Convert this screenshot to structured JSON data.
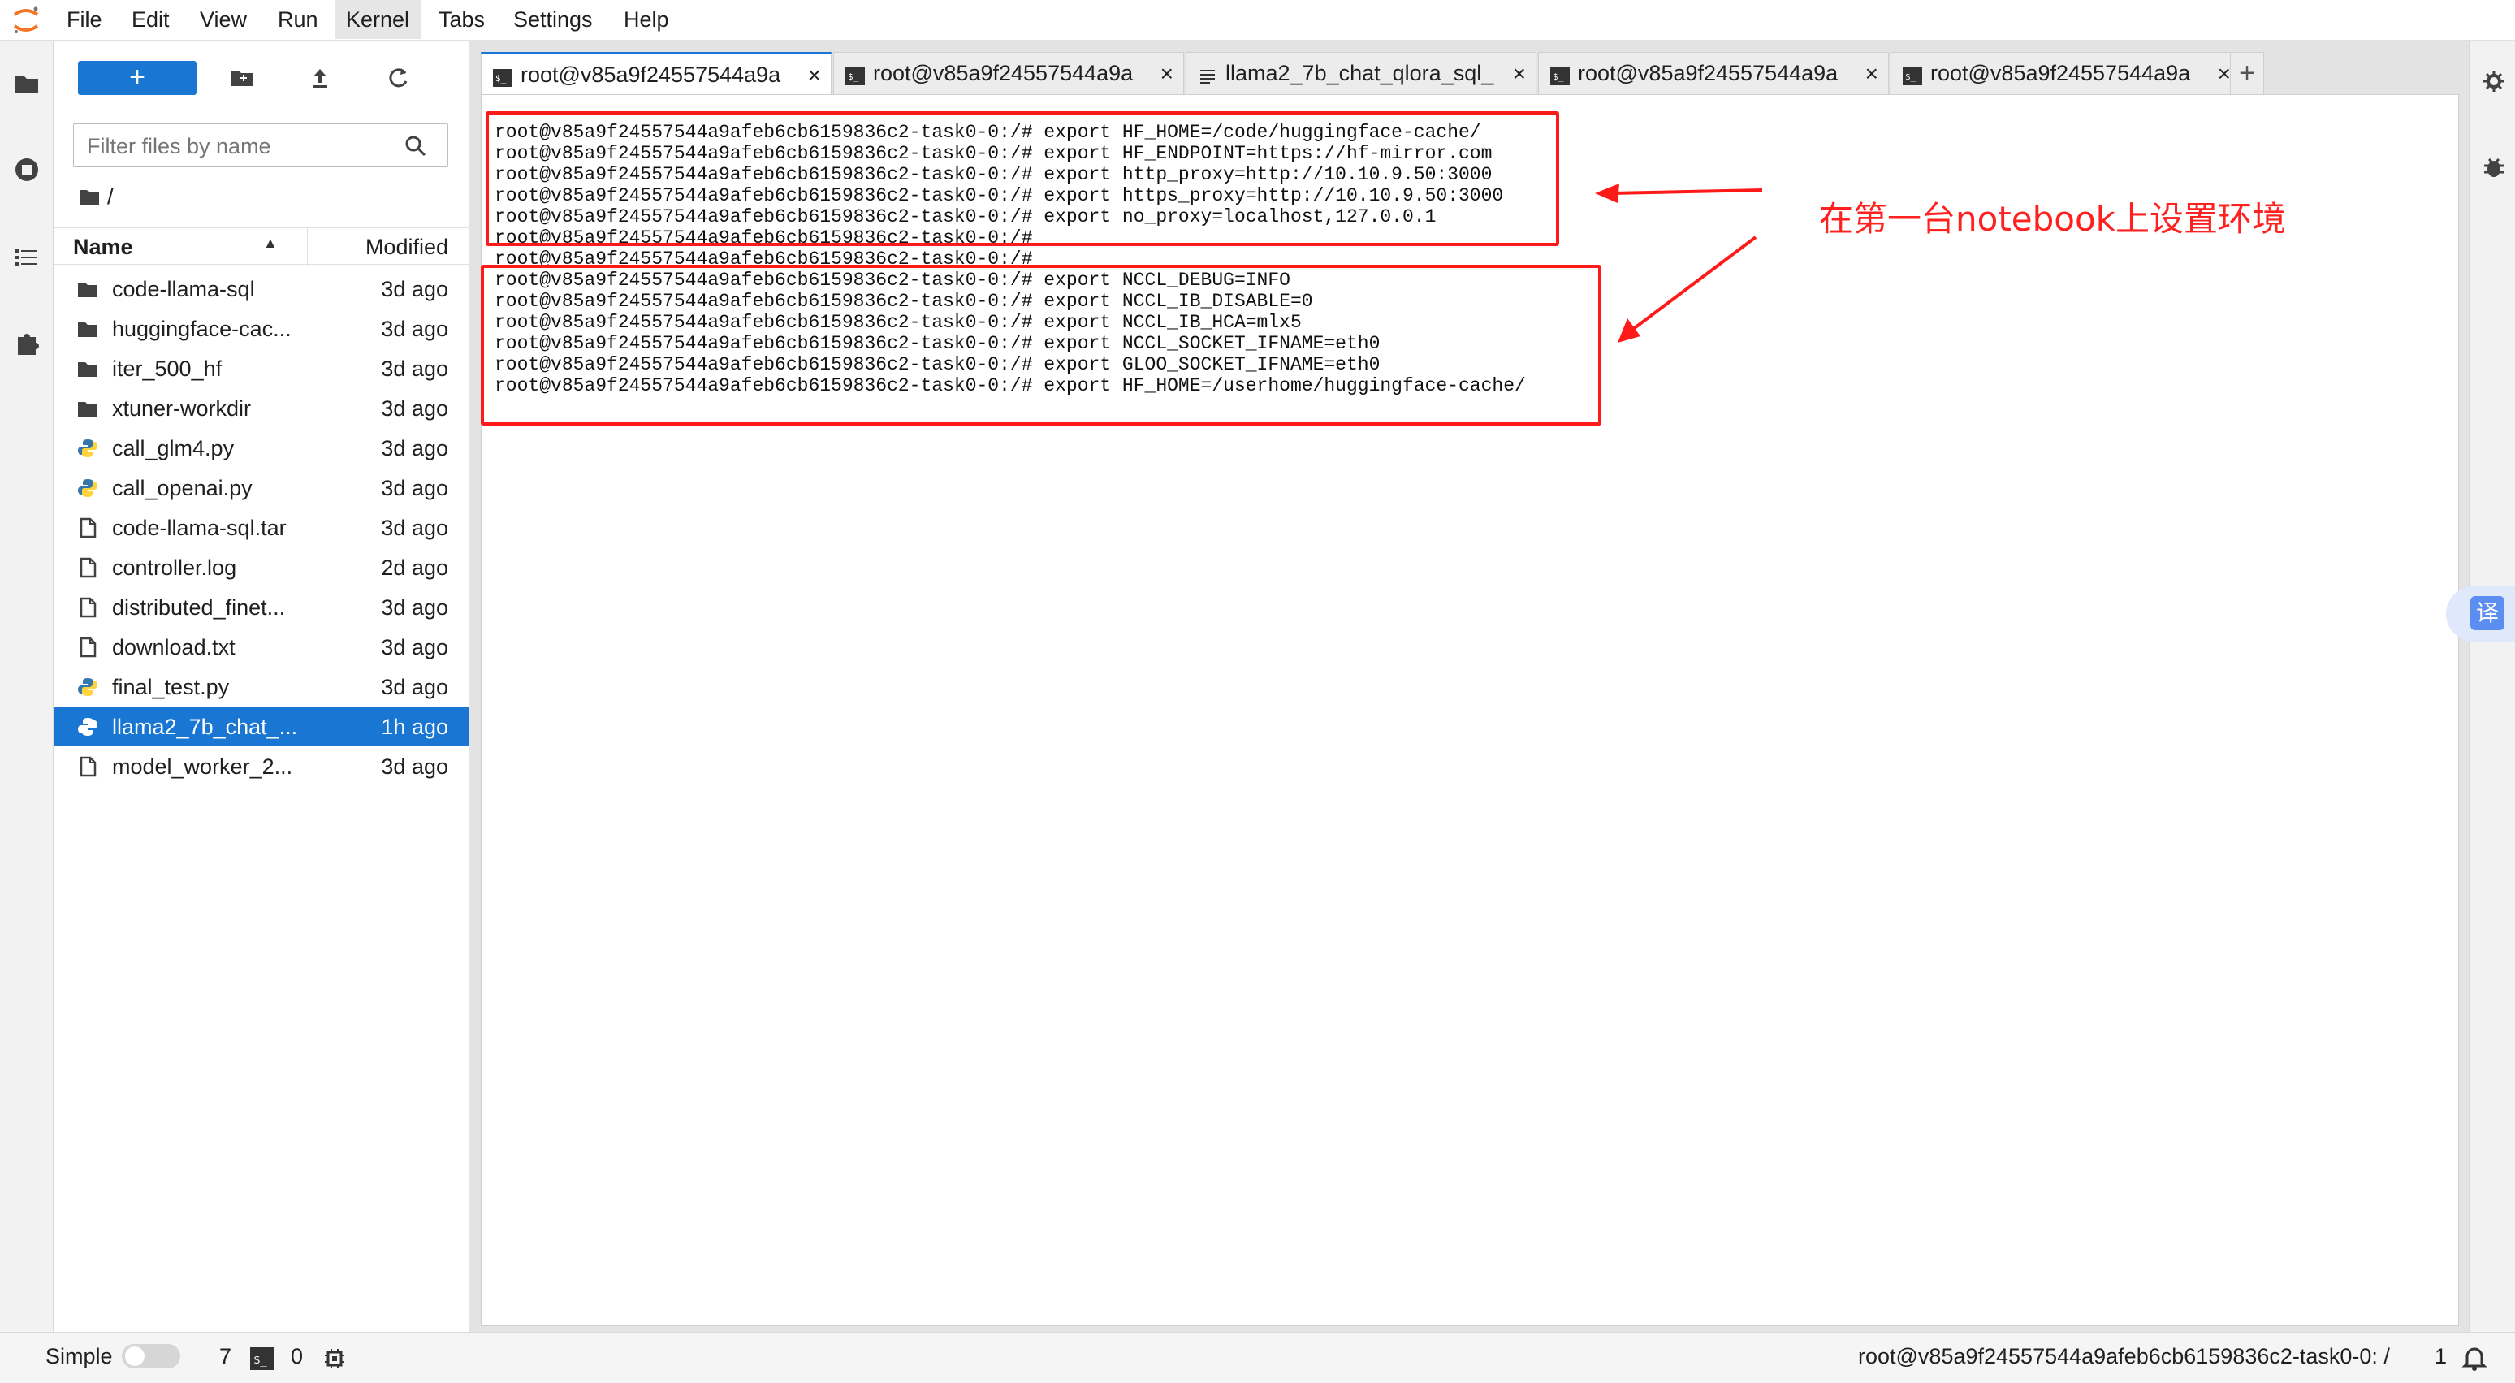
{
  "menubar": {
    "items": [
      "File",
      "Edit",
      "View",
      "Run",
      "Kernel",
      "Tabs",
      "Settings",
      "Help"
    ],
    "active": "Kernel"
  },
  "filebrowser": {
    "new_button_label": "+",
    "filter_placeholder": "Filter files by name",
    "breadcrumb": "/",
    "columns": {
      "name": "Name",
      "modified": "Modified"
    },
    "files": [
      {
        "name": "code-llama-sql",
        "modified": "3d ago",
        "icon": "folder-icon"
      },
      {
        "name": "huggingface-cac...",
        "modified": "3d ago",
        "icon": "folder-icon"
      },
      {
        "name": "iter_500_hf",
        "modified": "3d ago",
        "icon": "folder-icon"
      },
      {
        "name": "xtuner-workdir",
        "modified": "3d ago",
        "icon": "folder-icon"
      },
      {
        "name": "call_glm4.py",
        "modified": "3d ago",
        "icon": "python-icon"
      },
      {
        "name": "call_openai.py",
        "modified": "3d ago",
        "icon": "python-icon"
      },
      {
        "name": "code-llama-sql.tar",
        "modified": "3d ago",
        "icon": "file-icon"
      },
      {
        "name": "controller.log",
        "modified": "2d ago",
        "icon": "file-icon"
      },
      {
        "name": "distributed_finet...",
        "modified": "3d ago",
        "icon": "file-icon"
      },
      {
        "name": "download.txt",
        "modified": "3d ago",
        "icon": "file-icon"
      },
      {
        "name": "final_test.py",
        "modified": "3d ago",
        "icon": "python-icon"
      },
      {
        "name": "llama2_7b_chat_...",
        "modified": "1h ago",
        "icon": "python-icon",
        "selected": true
      },
      {
        "name": "model_worker_2...",
        "modified": "3d ago",
        "icon": "file-icon"
      }
    ]
  },
  "tabs": [
    {
      "label": "root@v85a9f24557544a9a",
      "icon": "terminal-icon",
      "active": true
    },
    {
      "label": "root@v85a9f24557544a9a",
      "icon": "terminal-icon"
    },
    {
      "label": "llama2_7b_chat_qlora_sql_",
      "icon": "text-file-icon"
    },
    {
      "label": "root@v85a9f24557544a9a",
      "icon": "terminal-icon"
    },
    {
      "label": "root@v85a9f24557544a9a",
      "icon": "terminal-icon"
    }
  ],
  "add_tab_label": "+",
  "terminal": {
    "lines": [
      "root@v85a9f24557544a9afeb6cb6159836c2-task0-0:/# export HF_HOME=/code/huggingface-cache/",
      "root@v85a9f24557544a9afeb6cb6159836c2-task0-0:/# export HF_ENDPOINT=https://hf-mirror.com",
      "root@v85a9f24557544a9afeb6cb6159836c2-task0-0:/# export http_proxy=http://10.10.9.50:3000",
      "root@v85a9f24557544a9afeb6cb6159836c2-task0-0:/# export https_proxy=http://10.10.9.50:3000",
      "root@v85a9f24557544a9afeb6cb6159836c2-task0-0:/# export no_proxy=localhost,127.0.0.1",
      "root@v85a9f24557544a9afeb6cb6159836c2-task0-0:/#",
      "root@v85a9f24557544a9afeb6cb6159836c2-task0-0:/#",
      "root@v85a9f24557544a9afeb6cb6159836c2-task0-0:/# export NCCL_DEBUG=INFO",
      "root@v85a9f24557544a9afeb6cb6159836c2-task0-0:/# export NCCL_IB_DISABLE=0",
      "root@v85a9f24557544a9afeb6cb6159836c2-task0-0:/# export NCCL_IB_HCA=mlx5",
      "root@v85a9f24557544a9afeb6cb6159836c2-task0-0:/# export NCCL_SOCKET_IFNAME=eth0",
      "root@v85a9f24557544a9afeb6cb6159836c2-task0-0:/# export GLOO_SOCKET_IFNAME=eth0",
      "root@v85a9f24557544a9afeb6cb6159836c2-task0-0:/# export HF_HOME=/userhome/huggingface-cache/"
    ]
  },
  "annotation": "在第一台notebook上设置环境",
  "translate_label": "译",
  "statusbar": {
    "mode_label": "Simple",
    "terminals_count": "7",
    "kernels_count": "0",
    "path": "root@v85a9f24557544a9afeb6cb6159836c2-task0-0: /",
    "notifications": "1"
  },
  "colors": {
    "accent": "#1976d2",
    "annotation": "#ff1a1a"
  }
}
